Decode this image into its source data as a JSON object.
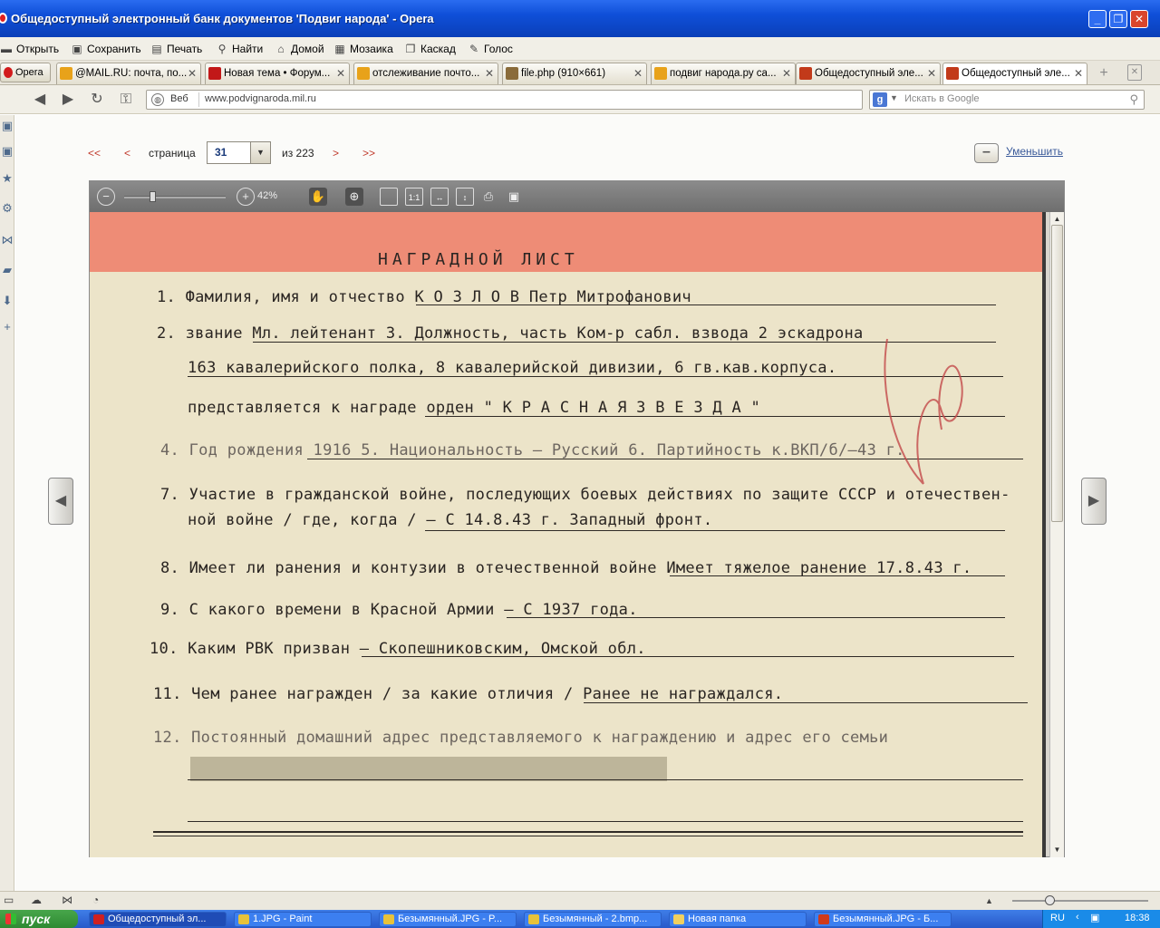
{
  "window": {
    "title": "Общедоступный электронный банк документов 'Подвиг народа' - Opera",
    "buttons": [
      "_",
      "❐",
      "✕"
    ]
  },
  "menu": {
    "items": [
      {
        "label": "Открыть",
        "icon": "folder-icon"
      },
      {
        "label": "Сохранить",
        "icon": "save-icon"
      },
      {
        "label": "Печать",
        "icon": "print-icon"
      },
      {
        "label": "Найти",
        "icon": "find-icon"
      },
      {
        "label": "Домой",
        "icon": "home-icon"
      },
      {
        "label": "Мозаика",
        "icon": "tile-icon"
      },
      {
        "label": "Каскад",
        "icon": "cascade-icon"
      },
      {
        "label": "Голос",
        "icon": "voice-icon"
      }
    ]
  },
  "tabs": {
    "opera_label": "Opera",
    "items": [
      {
        "label": "@MAIL.RU: почта, по...",
        "color": "#e8a21a"
      },
      {
        "label": "Новая тема • Форум...",
        "color": "#c21818"
      },
      {
        "label": "отслеживание почто...",
        "color": "#e8a21a"
      },
      {
        "label": "file.php (910×661)",
        "color": "#8a6b3a"
      },
      {
        "label": "подвиг народа.ру са...",
        "color": "#e8a21a"
      },
      {
        "label": "Общедоступный эле...",
        "color": "#c23a1a"
      },
      {
        "label": "Общедоступный эле...",
        "color": "#c23a1a"
      }
    ]
  },
  "address": {
    "web_label": "Веб",
    "url": "www.podvignaroda.mil.ru",
    "search_placeholder": "Искать в Google"
  },
  "pager": {
    "first": "<<",
    "prev": "<",
    "page_label": "страница",
    "current_page": "31",
    "of_label": "из 223",
    "next": ">",
    "last": ">>",
    "zoom_out_label": "Уменьшить"
  },
  "viewer": {
    "zoom_percent": "42%",
    "zoom_level": 0.42
  },
  "document": {
    "title": "НАГРАДНОЙ ЛИСТ",
    "lines": [
      "1. Фамилия, имя и отчество  К О З Л О В   Петр Митрофанович",
      "2. звание  Мл. лейтенант                3. Должность, часть  Ком-р сабл. взвода 2 эскадрона",
      "163 кавалерийского полка, 8 кавалерийской дивизии, 6 гв.кав.корпуса.",
      "представляется к награде  орден \" К Р А С Н А Я  З В Е З Д А \"",
      "4. Год рождения 1916   5. Национальность – Русский          6. Партийность  к.ВКП/б/–43 г.",
      "7. Участие в гражданской войне, последующих боевых действиях по защите СССР и отечествен-",
      "ной войне / где, когда /  – С 14.8.43 г. Западный фронт.",
      "8. Имеет ли ранения и контузии в отечественной войне  Имеет тяжелое ранение 17.8.43 г.",
      "9. С какого времени в Красной Армии  – С 1937 года.",
      "10. Каким РВК призван  – Скопешниковским, Омской обл.",
      "11. Чем ранее награжден / за какие отличия /  Ранее не награждался.",
      "12. Постоянный домашний адрес представляемого к награждению и адрес его семьи"
    ]
  },
  "statusbar": {
    "icons": [
      "panel-icon",
      "cloud-icon",
      "share-icon",
      "speed-icon"
    ]
  },
  "taskbar": {
    "start_label": "пуск",
    "items": [
      {
        "label": "Общедоступный эл...",
        "color": "#d02020"
      },
      {
        "label": "1.JPG - Paint",
        "color": "#e8c23a"
      },
      {
        "label": "Безымянный.JPG - P...",
        "color": "#e8c23a"
      },
      {
        "label": "Безымянный - 2.bmp...",
        "color": "#e8c23a"
      },
      {
        "label": "Новая папка",
        "color": "#f0d060"
      },
      {
        "label": "Безымянный.JPG - Б...",
        "color": "#d03a1a"
      }
    ],
    "lang": "RU",
    "clock": "18:38"
  }
}
